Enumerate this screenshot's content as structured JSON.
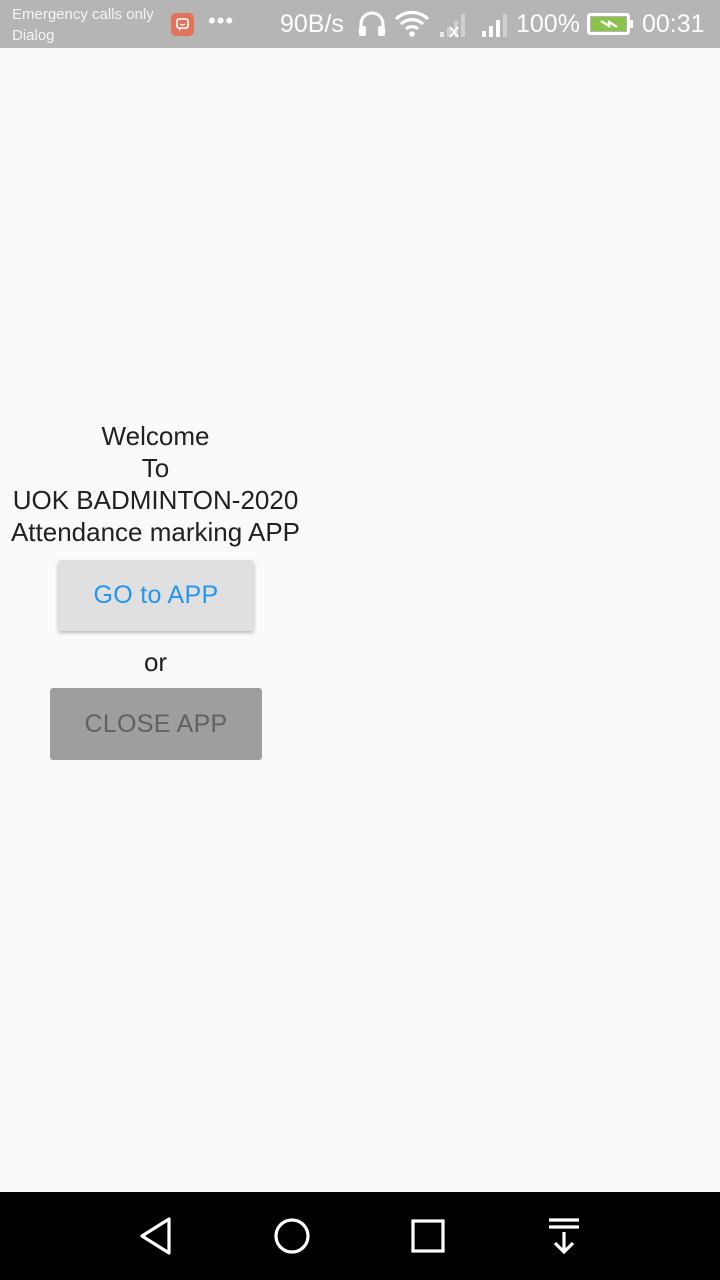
{
  "status_bar": {
    "carrier_line1": "Emergency calls only",
    "carrier_line2": "Dialog",
    "more_icon": "•••",
    "net_speed": "90B/s",
    "battery_percent": "100%",
    "time": "00:31",
    "icons": [
      "notification-app-icon",
      "more-icon",
      "headphones-icon",
      "wifi-icon",
      "sim1-no-signal-icon",
      "sim2-signal-icon",
      "battery-charging-icon"
    ]
  },
  "welcome": {
    "line1": "Welcome",
    "line2": "To",
    "line3": "UOK BADMINTON-2020",
    "line4": "Attendance marking APP"
  },
  "buttons": {
    "go_to_app": "GO to APP",
    "or_text": "or",
    "close_app": "CLOSE APP"
  },
  "nav_bar": {
    "icons": [
      "back-icon",
      "home-icon",
      "recents-icon",
      "notification-drawer-icon"
    ]
  },
  "colors": {
    "status_bar_bg": "#b5b5b5",
    "page_bg": "#fafafa",
    "go_button_bg": "#e0e0e0",
    "go_button_text": "#2196f3",
    "close_button_bg": "#9e9e9e",
    "close_button_text": "#616161",
    "battery_fill": "#8bc34a",
    "nav_bar_bg": "#000000"
  }
}
